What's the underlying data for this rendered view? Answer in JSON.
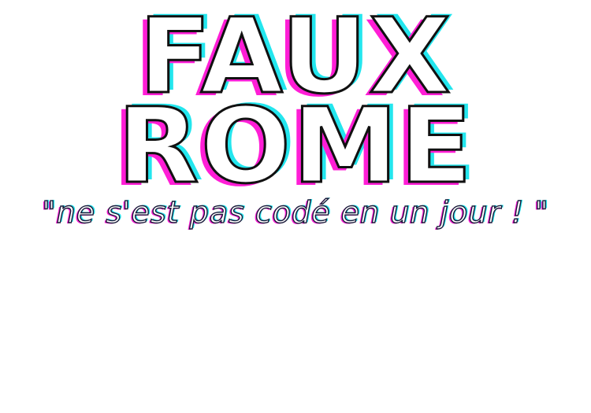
{
  "logo": {
    "line1": "FAUX",
    "line2": "ROME"
  },
  "tagline": "\"ne s'est pas codé en un jour ! \"",
  "colors": {
    "background": "#ffffff",
    "glitch_magenta": "#ff1ed6",
    "glitch_cyan": "#23e6ee",
    "outline": "#111111"
  }
}
